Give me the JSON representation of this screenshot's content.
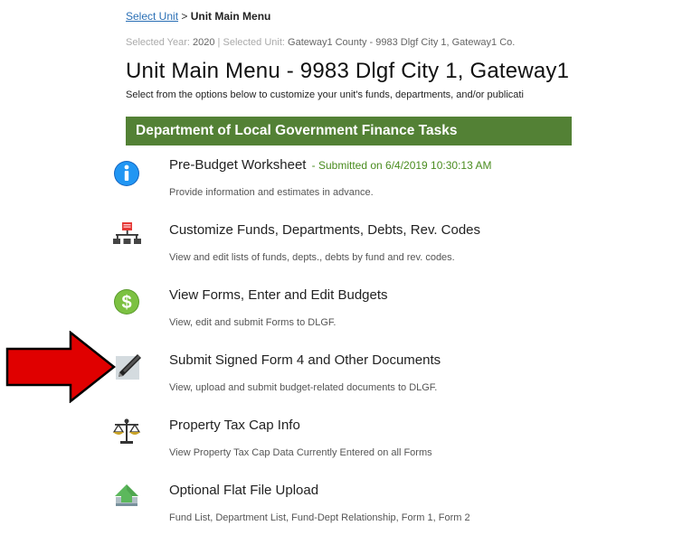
{
  "breadcrumb": {
    "link": "Select Unit",
    "separator": " > ",
    "current": "Unit Main Menu"
  },
  "selected": {
    "year_label": "Selected Year:",
    "year_value": "2020",
    "divider": " | ",
    "unit_label": "Selected Unit:",
    "unit_value": "Gateway1 County - 9983 Dlgf City 1, Gateway1 Co."
  },
  "page_title": "Unit Main Menu - 9983 Dlgf City 1, Gateway1",
  "page_subtitle": "Select from the options below to customize your unit's funds, departments, and/or publicati",
  "section_header": "Department of Local Government Finance Tasks",
  "tasks": [
    {
      "title": "Pre-Budget Worksheet",
      "status": "- Submitted on 6/4/2019 10:30:13 AM",
      "desc": "Provide information and estimates in advance.",
      "icon": "info-icon"
    },
    {
      "title": "Customize Funds, Departments, Debts, Rev. Codes",
      "status": "",
      "desc": "View and edit lists of funds, depts., debts by fund and rev. codes.",
      "icon": "org-chart-icon"
    },
    {
      "title": "View Forms, Enter and Edit Budgets",
      "status": "",
      "desc": "View, edit and submit Forms to DLGF.",
      "icon": "dollar-icon"
    },
    {
      "title": "Submit Signed Form 4 and Other Documents",
      "status": "",
      "desc": "View, upload and submit budget-related documents to DLGF.",
      "icon": "pen-icon"
    },
    {
      "title": "Property Tax Cap Info",
      "status": "",
      "desc": "View Property Tax Cap Data Currently Entered on all Forms",
      "icon": "scales-icon"
    },
    {
      "title": "Optional Flat File Upload",
      "status": "",
      "desc": "Fund List, Department List, Fund-Dept Relationship, Form 1, Form 2",
      "icon": "upload-icon"
    }
  ],
  "colors": {
    "section_header_bg": "#538135",
    "status_text": "#4a8c1f",
    "link": "#2a6fb5",
    "arrow": "#e00000"
  }
}
